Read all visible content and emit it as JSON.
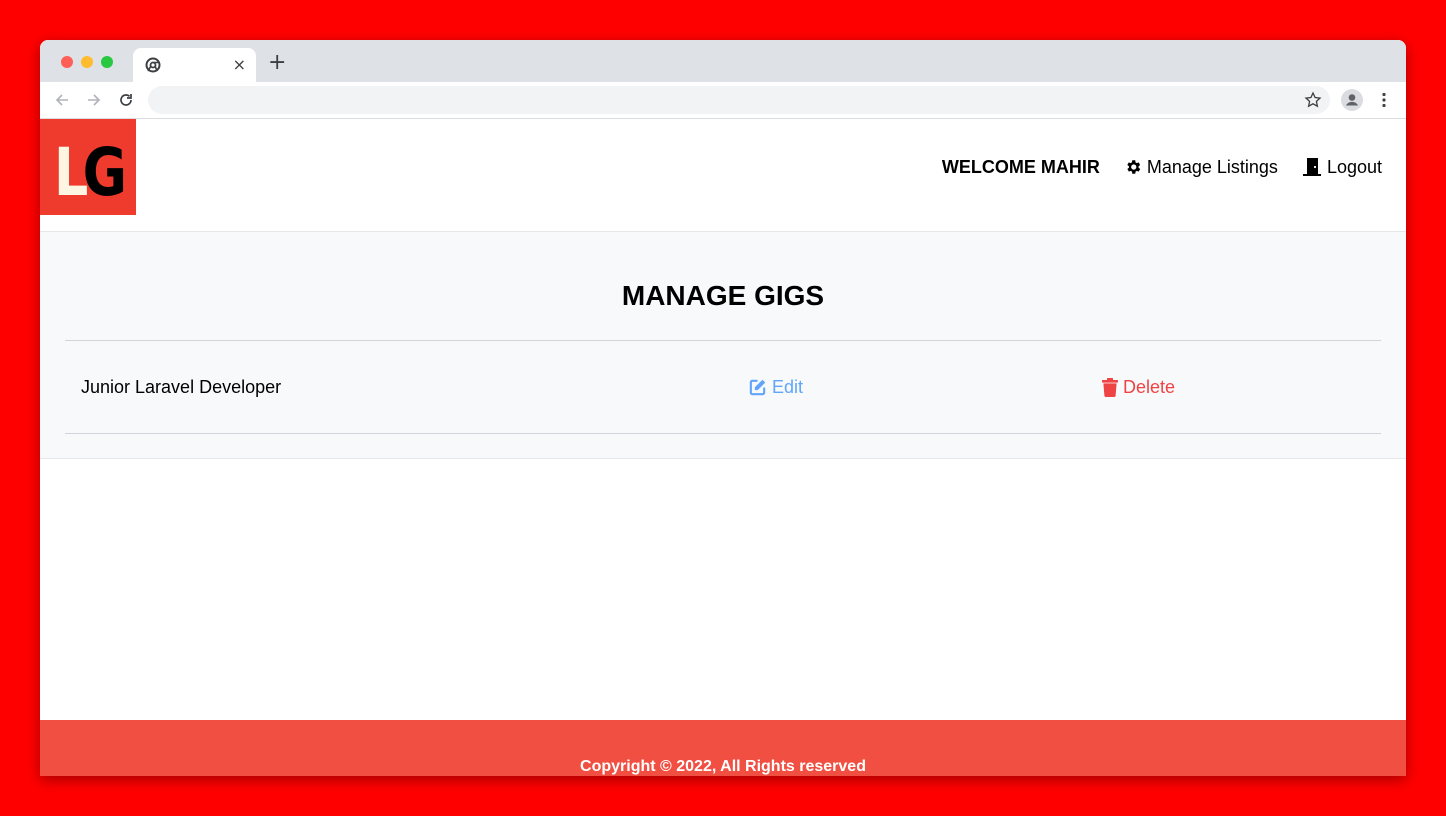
{
  "browser": {
    "tab_close": "×",
    "new_tab": "+"
  },
  "navbar": {
    "logo_text": "LG",
    "welcome": "WELCOME MAHIR",
    "manage_listings": "Manage Listings",
    "logout": "Logout"
  },
  "main": {
    "title": "MANAGE GIGS",
    "gigs": [
      {
        "title": "Junior Laravel Developer",
        "edit_label": "Edit",
        "delete_label": "Delete"
      }
    ]
  },
  "footer": {
    "copyright": "Copyright © 2022, All Rights reserved"
  },
  "colors": {
    "background": "#ff0000",
    "brand_red": "#ef3b2d",
    "footer_red": "#f04f42",
    "edit_blue": "#60a5fa",
    "delete_red": "#ef4444",
    "logo_cream": "#fdf6e3"
  },
  "icons": [
    "chrome-favicon-icon",
    "back-arrow-icon",
    "forward-arrow-icon",
    "reload-icon",
    "star-icon",
    "profile-icon",
    "kebab-menu-icon",
    "gear-icon",
    "door-icon",
    "edit-icon",
    "trash-icon"
  ]
}
